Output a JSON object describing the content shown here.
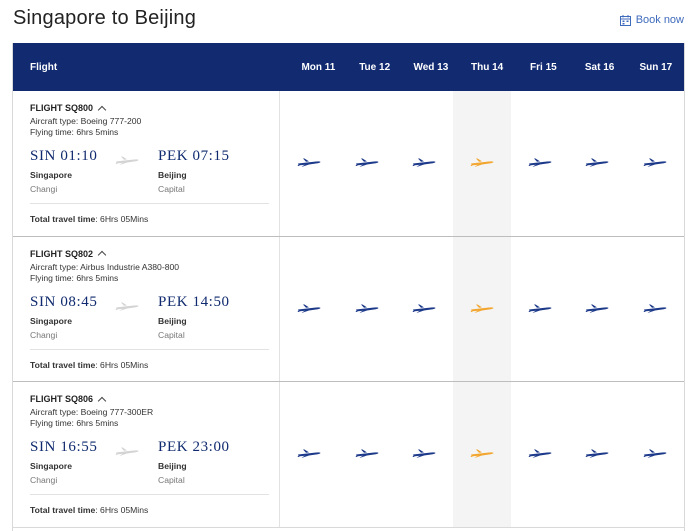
{
  "title": "Singapore to Beijing",
  "book_now": "Book now",
  "colors": {
    "header_bg": "#112a70",
    "plane_default": "#1d3a8a",
    "plane_selected": "#f2a62f",
    "link": "#3f6bbd"
  },
  "table": {
    "flight_header": "Flight",
    "days": [
      "Mon 11",
      "Tue 12",
      "Wed 13",
      "Thu 14",
      "Fri 15",
      "Sat 16",
      "Sun 17"
    ],
    "selected_day_index": 3,
    "flights": [
      {
        "flight": "FLIGHT SQ800",
        "aircraft": "Aircraft type: Boeing 777-200",
        "flying_time": "Flying time: 6hrs 5mins",
        "dep_time": "SIN 01:10",
        "dep_city": "Singapore",
        "dep_airport": "Changi",
        "arr_time": "PEK 07:15",
        "arr_city": "Beijing",
        "arr_airport": "Capital",
        "total_label": "Total travel time",
        "total_value": ": 6Hrs 05Mins"
      },
      {
        "flight": "FLIGHT SQ802",
        "aircraft": "Aircraft type: Airbus Industrie A380-800",
        "flying_time": "Flying time: 6hrs 5mins",
        "dep_time": "SIN 08:45",
        "dep_city": "Singapore",
        "dep_airport": "Changi",
        "arr_time": "PEK 14:50",
        "arr_city": "Beijing",
        "arr_airport": "Capital",
        "total_label": "Total travel time",
        "total_value": ": 6Hrs 05Mins"
      },
      {
        "flight": "FLIGHT SQ806",
        "aircraft": "Aircraft type: Boeing 777-300ER",
        "flying_time": "Flying time: 6hrs 5mins",
        "dep_time": "SIN 16:55",
        "dep_city": "Singapore",
        "dep_airport": "Changi",
        "arr_time": "PEK 23:00",
        "arr_city": "Beijing",
        "arr_airport": "Capital",
        "total_label": "Total travel time",
        "total_value": ": 6Hrs 05Mins"
      }
    ]
  }
}
